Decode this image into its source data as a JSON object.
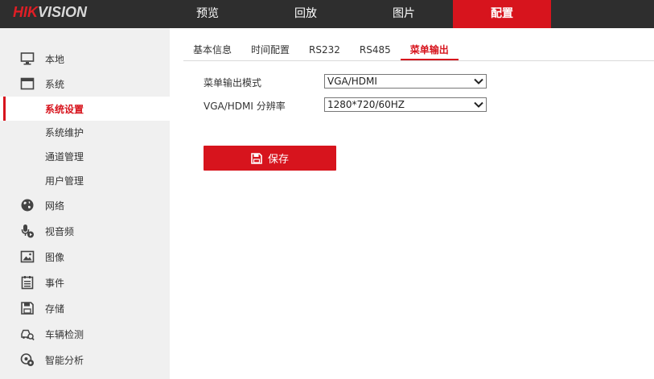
{
  "brand": {
    "logo_part1": "HIK",
    "logo_part2": "VISION"
  },
  "nav": {
    "items": [
      {
        "label": "预览"
      },
      {
        "label": "回放"
      },
      {
        "label": "图片"
      },
      {
        "label": "配置"
      }
    ],
    "active_index": 3
  },
  "sidebar": {
    "items": [
      {
        "label": "本地",
        "icon": "monitor-icon"
      },
      {
        "label": "系统",
        "icon": "system-window-icon"
      },
      {
        "label": "系统设置"
      },
      {
        "label": "系统维护"
      },
      {
        "label": "通道管理"
      },
      {
        "label": "用户管理"
      },
      {
        "label": "网络",
        "icon": "globe-icon"
      },
      {
        "label": "视音频",
        "icon": "microphone-icon"
      },
      {
        "label": "图像",
        "icon": "image-icon"
      },
      {
        "label": "事件",
        "icon": "event-list-icon"
      },
      {
        "label": "存储",
        "icon": "floppy-disk-icon"
      },
      {
        "label": "车辆检测",
        "icon": "vehicle-search-icon"
      },
      {
        "label": "智能分析",
        "icon": "smart-analysis-icon"
      }
    ],
    "selected_index": 2
  },
  "tabs": {
    "items": [
      {
        "label": "基本信息"
      },
      {
        "label": "时间配置"
      },
      {
        "label": "RS232"
      },
      {
        "label": "RS485"
      },
      {
        "label": "菜单输出"
      }
    ],
    "active_index": 4
  },
  "form": {
    "menu_output_mode": {
      "label": "菜单输出模式",
      "value": "VGA/HDMI"
    },
    "resolution": {
      "label": "VGA/HDMI 分辨率",
      "value": "1280*720/60HZ"
    }
  },
  "actions": {
    "save_label": "保存"
  },
  "colors": {
    "accent": "#d7141d",
    "topbar": "#2e2e2e",
    "sidebar_bg": "#f0f0f0"
  }
}
